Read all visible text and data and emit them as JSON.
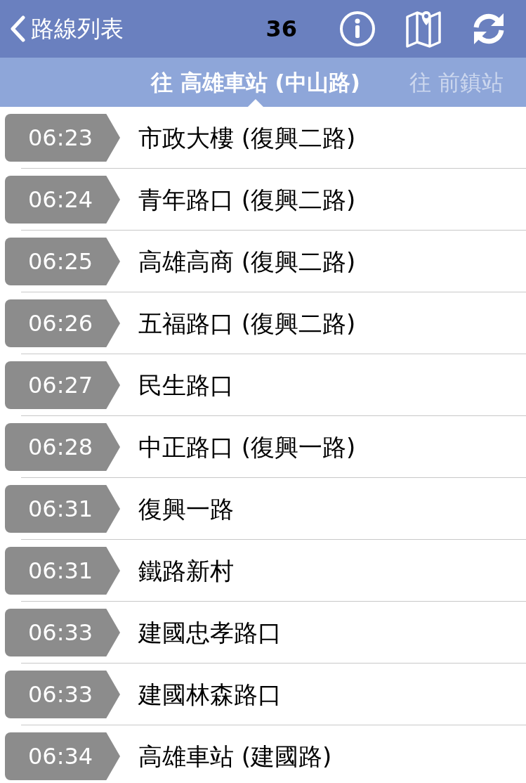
{
  "header": {
    "back_label": "路線列表",
    "route_number": "36"
  },
  "tabs": [
    {
      "label": "往 高雄車站 (中山路)",
      "selected": true
    },
    {
      "label": "往 前鎮站",
      "selected": false
    }
  ],
  "stops": [
    {
      "time": "06:23",
      "name": "市政大樓 (復興二路)"
    },
    {
      "time": "06:24",
      "name": "青年路口 (復興二路)"
    },
    {
      "time": "06:25",
      "name": "高雄高商 (復興二路)"
    },
    {
      "time": "06:26",
      "name": "五福路口 (復興二路)"
    },
    {
      "time": "06:27",
      "name": "民生路口"
    },
    {
      "time": "06:28",
      "name": "中正路口 (復興一路)"
    },
    {
      "time": "06:31",
      "name": "復興一路"
    },
    {
      "time": "06:31",
      "name": "鐵路新村"
    },
    {
      "time": "06:33",
      "name": "建國忠孝路口"
    },
    {
      "time": "06:33",
      "name": "建國林森路口"
    },
    {
      "time": "06:34",
      "name": "高雄車站 (建國路)"
    }
  ]
}
